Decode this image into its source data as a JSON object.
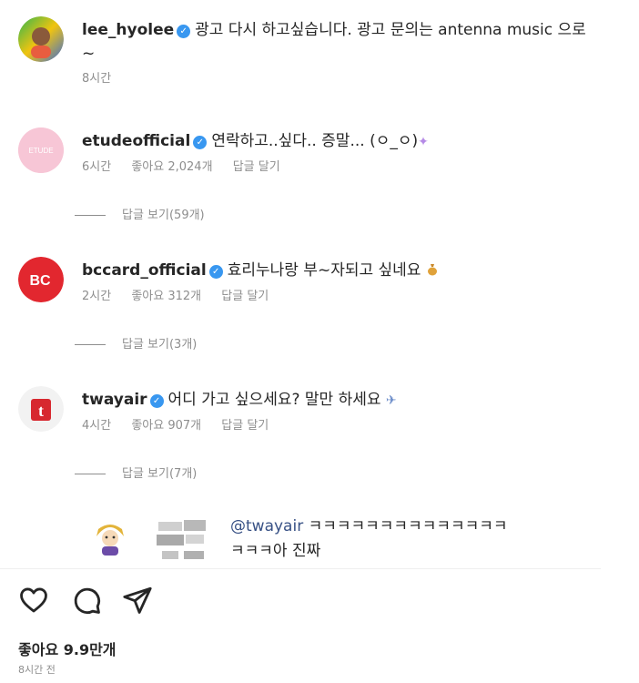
{
  "comments": [
    {
      "username": "lee_hyolee",
      "text": "광고 다시 하고싶습니다. 광고 문의는 antenna music 으로~",
      "time": "8시간"
    },
    {
      "username": "etudeofficial",
      "text": "연락하고..싶다.. 증말... (ㅇ_ㅇ)",
      "time": "6시간",
      "likes": "좋아요 2,024개",
      "reply": "답글 달기",
      "view_replies": "답글 보기(59개)",
      "avatar_text": "ETUDE",
      "emoji_icon": "sparkle-icon"
    },
    {
      "username": "bccard_official",
      "text": "효리누나랑 부~자되고 싶네요",
      "time": "2시간",
      "likes": "좋아요 312개",
      "reply": "답글 달기",
      "view_replies": "답글 보기(3개)",
      "avatar_text": "BC",
      "emoji_icon": "money-bag-icon"
    },
    {
      "username": "twayair",
      "text": "어디 가고 싶으세요? 말만 하세요",
      "time": "4시간",
      "likes": "좋아요 907개",
      "reply": "답글 달기",
      "view_replies": "답글 보기(7개)",
      "avatar_text": "t",
      "emoji_icon": "airplane-icon"
    }
  ],
  "sub_reply": {
    "mention": "@twayair",
    "text_line1": "ㅋㅋㅋㅋㅋㅋㅋㅋㅋㅋㅋㅋㅋㅋ",
    "text_line2": "ㅋㅋㅋ아 진짜"
  },
  "actions": [
    "heart-icon",
    "comment-icon",
    "share-icon"
  ],
  "footer": {
    "likes": "좋아요 9.9만개",
    "time_ago": "8시간 전"
  },
  "colors": {
    "verified": "#3897f0",
    "etude": "#f7c6d6",
    "bccard": "#e2272f",
    "tway": "#d7282f",
    "meta": "#8e8e8e"
  }
}
